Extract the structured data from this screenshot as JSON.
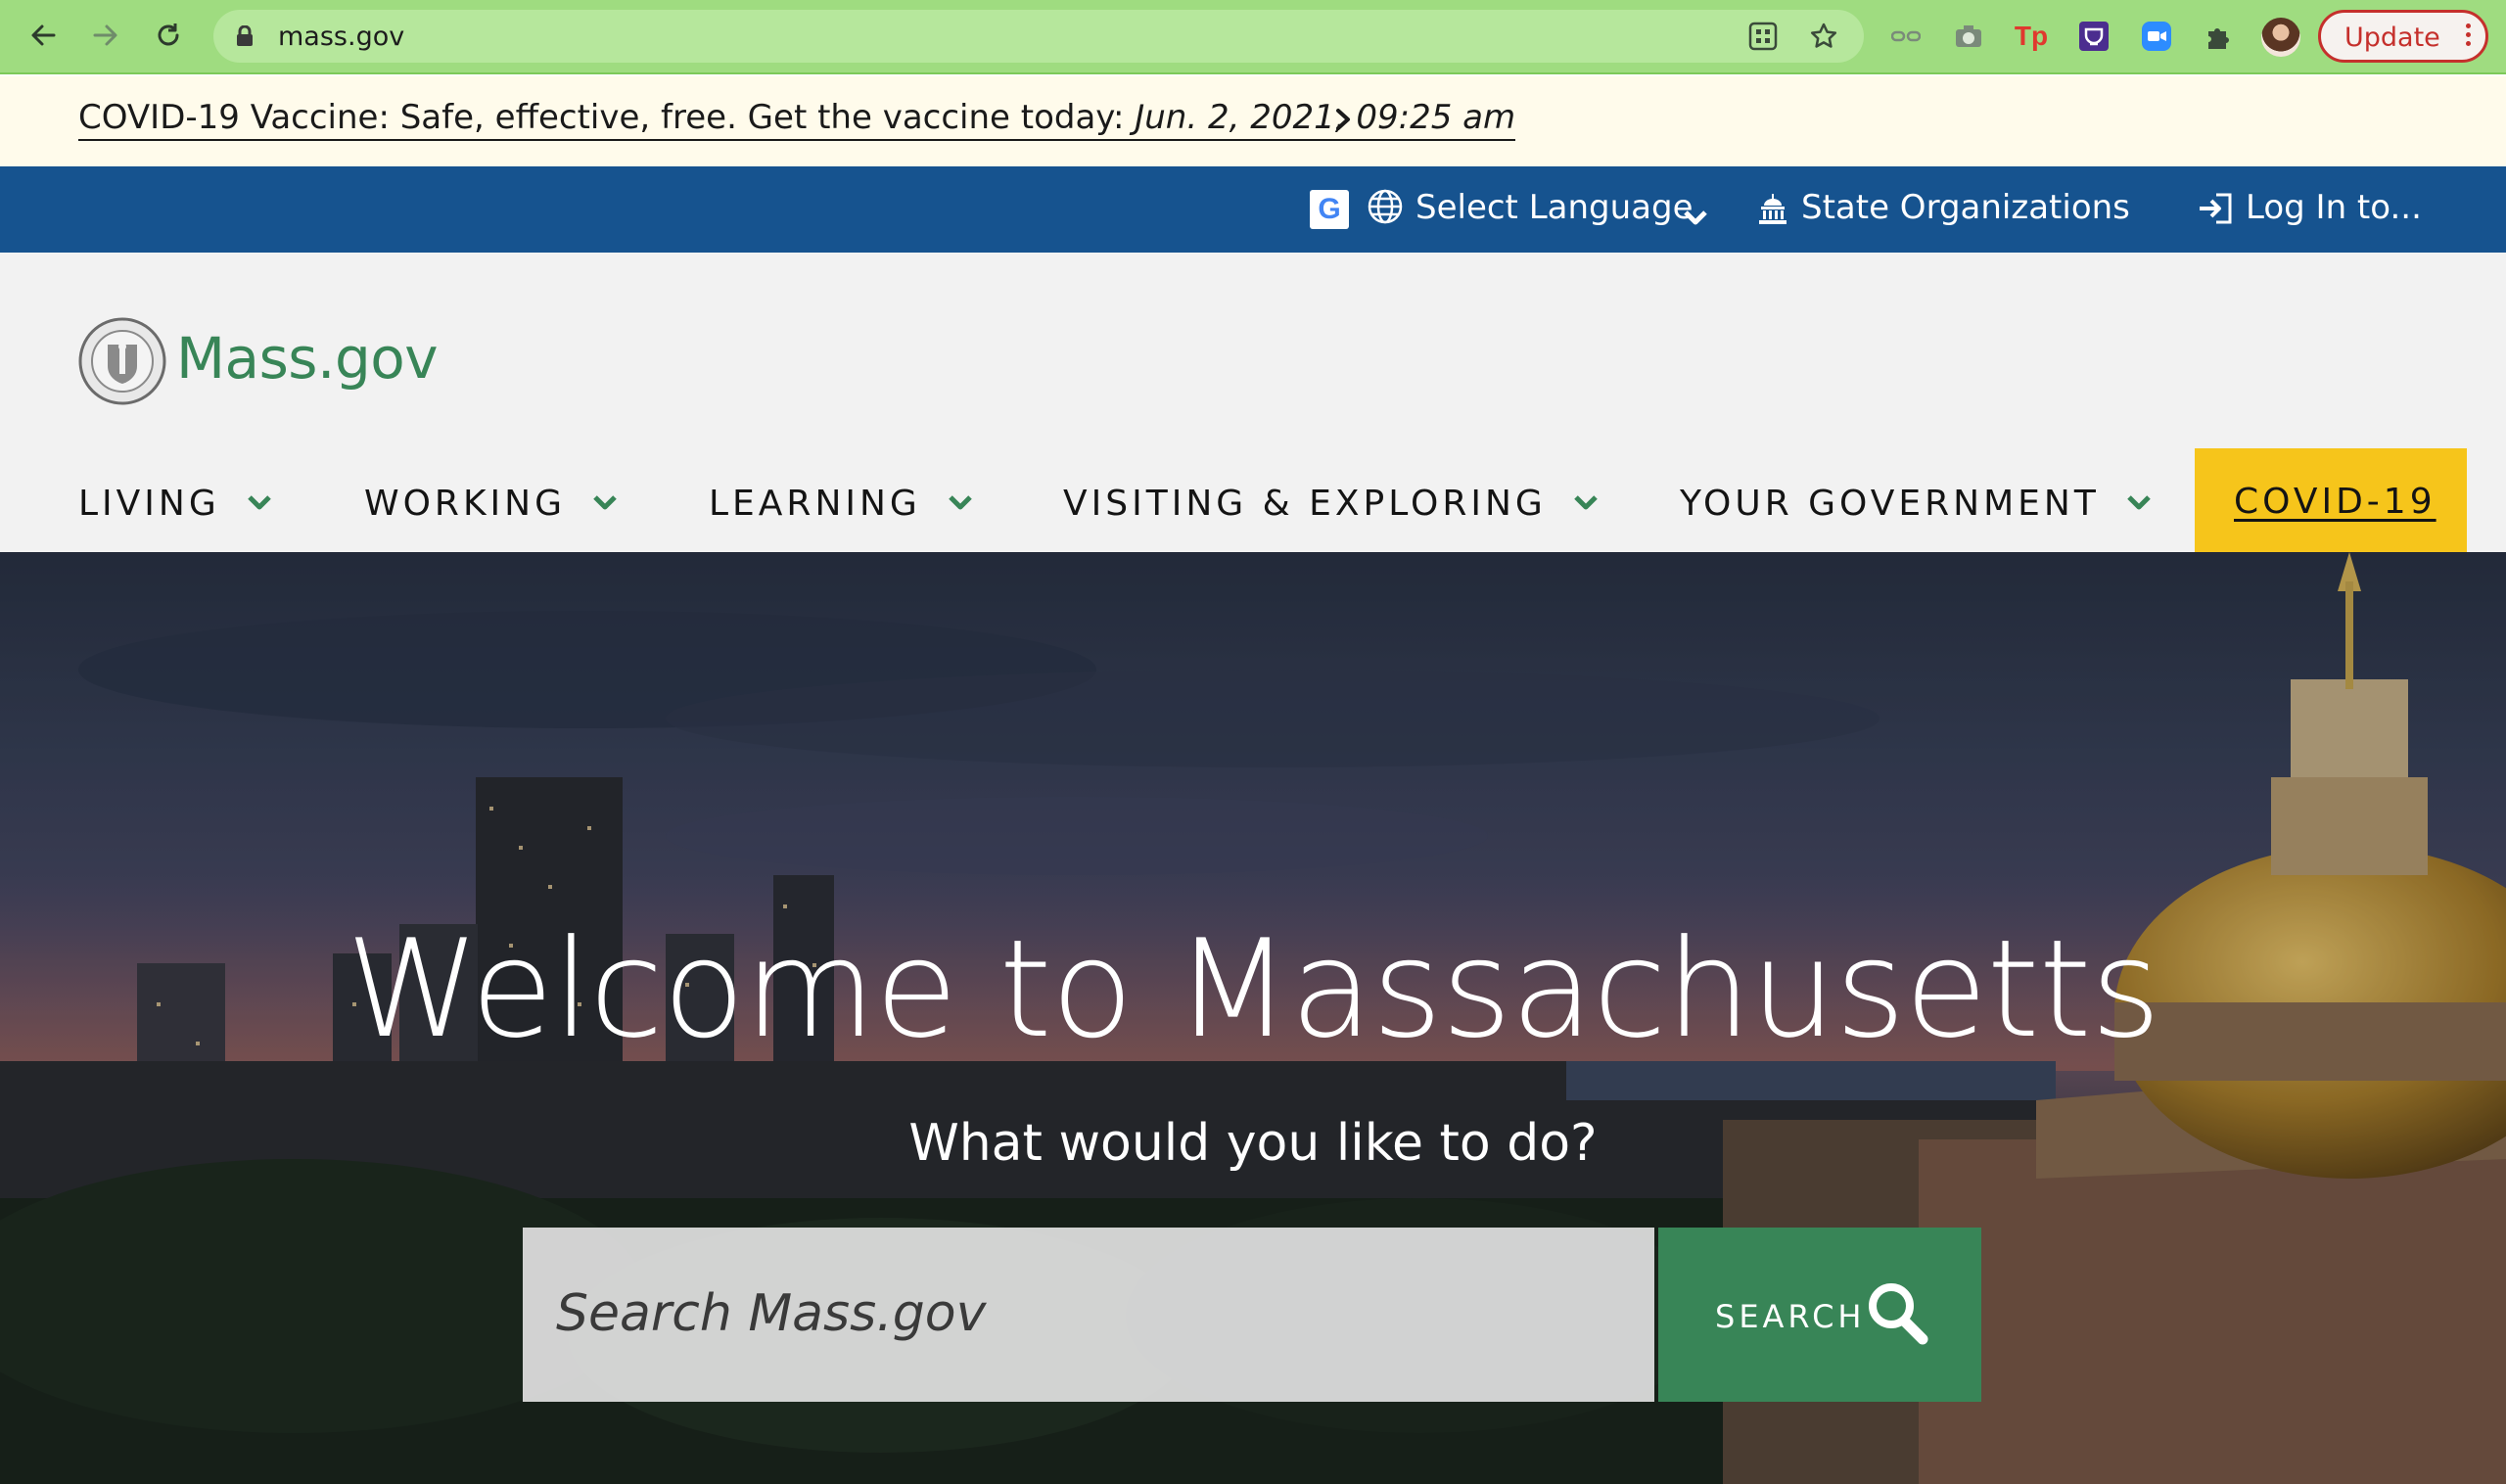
{
  "browser": {
    "url": "mass.gov",
    "update_label": "Update",
    "extension_badge": "Tp",
    "accent_color": "#9fdc80"
  },
  "alert": {
    "text": "COVID-19 Vaccine: Safe, effective, free. Get the vaccine today: ",
    "date": "Jun. 2, 2021, 09:25 am"
  },
  "utility": {
    "language_label": "Select Language",
    "orgs_label": "State Organizations",
    "login_label": "Log In to...",
    "bar_color": "#16538f"
  },
  "header": {
    "brand": "Mass.gov",
    "menu": [
      {
        "label": "LIVING"
      },
      {
        "label": "WORKING"
      },
      {
        "label": "LEARNING"
      },
      {
        "label": "VISITING & EXPLORING"
      },
      {
        "label": "YOUR GOVERNMENT"
      }
    ],
    "covid_label": "COVID-19",
    "brand_color": "#388557",
    "covid_color": "#f6c51b"
  },
  "hero": {
    "title": "Welcome to Massachusetts",
    "subtitle": "What would you like to do?",
    "search_placeholder": "Search Mass.gov",
    "search_button": "SEARCH"
  }
}
